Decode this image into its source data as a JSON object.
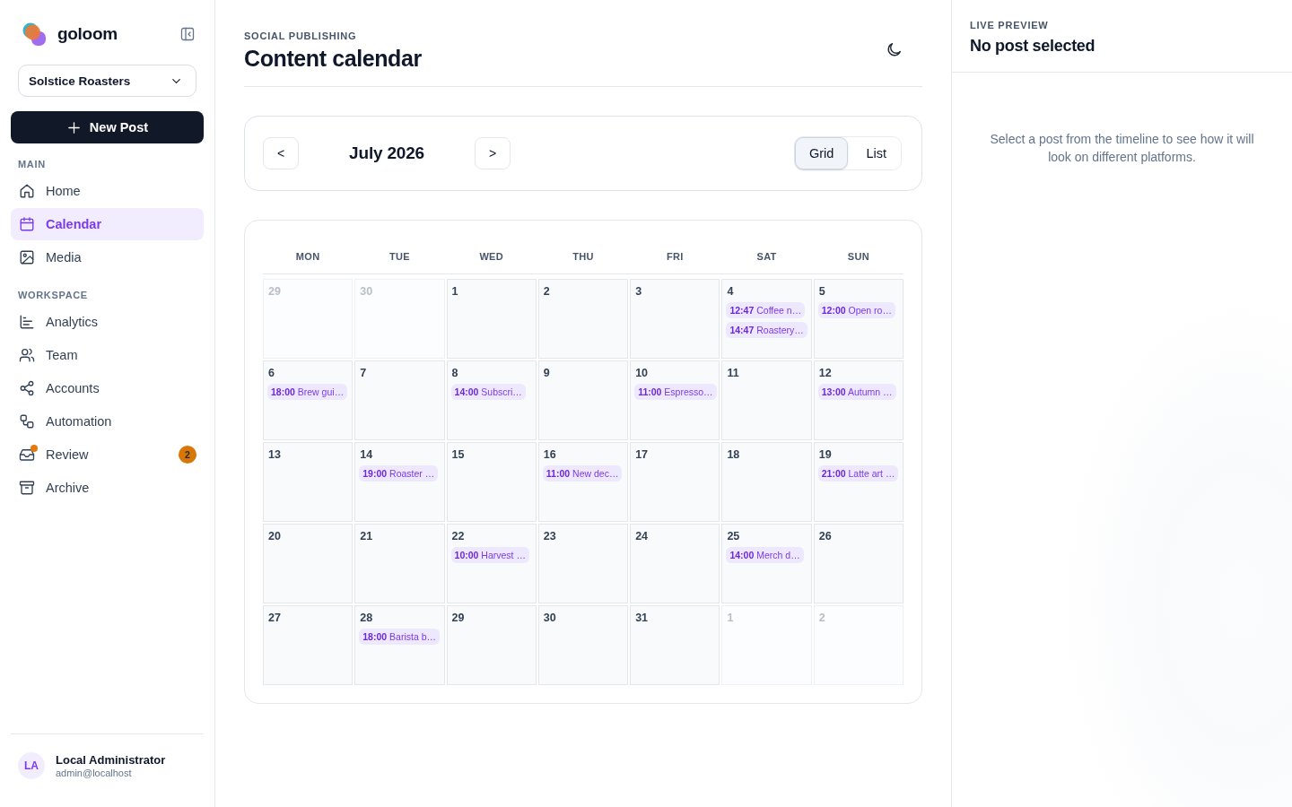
{
  "sidebar": {
    "brand": "goloom",
    "workspace_select": "Solstice Roasters",
    "new_post_button": "New Post",
    "sections": [
      {
        "label": "MAIN",
        "items": [
          {
            "label": "Home",
            "selected": false,
            "notification": false
          },
          {
            "label": "Calendar",
            "selected": true,
            "notification": false
          },
          {
            "label": "Media",
            "selected": false,
            "notification": false
          }
        ]
      },
      {
        "label": "WORKSPACE",
        "items": [
          {
            "label": "Analytics",
            "selected": false,
            "notification": false
          },
          {
            "label": "Team",
            "selected": false,
            "notification": false
          },
          {
            "label": "Accounts",
            "selected": false,
            "notification": false
          },
          {
            "label": "Automation",
            "selected": false,
            "notification": false
          },
          {
            "label": "Review",
            "selected": false,
            "notification": true,
            "badge": "2"
          },
          {
            "label": "Archive",
            "selected": false,
            "notification": false
          }
        ]
      }
    ],
    "user": {
      "initials": "LA",
      "name": "Local Administrator",
      "email": "admin@localhost"
    }
  },
  "header": {
    "eyebrow": "SOCIAL PUBLISHING",
    "title": "Content calendar"
  },
  "toolbar": {
    "prev": "<",
    "month": "July 2026",
    "next": ">",
    "views": [
      {
        "label": "Grid",
        "selected": true
      },
      {
        "label": "List",
        "selected": false
      }
    ]
  },
  "calendar": {
    "weekdays": [
      "MON",
      "TUE",
      "WED",
      "THU",
      "FRI",
      "SAT",
      "SUN"
    ],
    "weeks": [
      {
        "days": [
          {
            "day": "29",
            "in_month": false
          },
          {
            "day": "30",
            "in_month": false
          },
          {
            "day": "1",
            "in_month": true
          },
          {
            "day": "2",
            "in_month": true
          },
          {
            "day": "3",
            "in_month": true
          },
          {
            "day": "4",
            "in_month": true,
            "posts": [
              {
                "time": "12:47",
                "title": "Coffee n…"
              },
              {
                "time": "14:47",
                "title": "Roastery…"
              }
            ]
          },
          {
            "day": "5",
            "in_month": true,
            "posts": [
              {
                "time": "12:00",
                "title": "Open ro…"
              }
            ]
          }
        ]
      },
      {
        "days": [
          {
            "day": "6",
            "in_month": true,
            "posts": [
              {
                "time": "18:00",
                "title": "Brew gui…"
              }
            ]
          },
          {
            "day": "7",
            "in_month": true
          },
          {
            "day": "8",
            "in_month": true,
            "posts": [
              {
                "time": "14:00",
                "title": "Subscri…"
              }
            ]
          },
          {
            "day": "9",
            "in_month": true
          },
          {
            "day": "10",
            "in_month": true,
            "posts": [
              {
                "time": "11:00",
                "title": "Espresso…"
              }
            ]
          },
          {
            "day": "11",
            "in_month": true
          },
          {
            "day": "12",
            "in_month": true,
            "posts": [
              {
                "time": "13:00",
                "title": "Autumn …"
              }
            ]
          }
        ]
      },
      {
        "days": [
          {
            "day": "13",
            "in_month": true
          },
          {
            "day": "14",
            "in_month": true,
            "posts": [
              {
                "time": "19:00",
                "title": "Roaster …"
              }
            ]
          },
          {
            "day": "15",
            "in_month": true
          },
          {
            "day": "16",
            "in_month": true,
            "posts": [
              {
                "time": "11:00",
                "title": "New dec…"
              }
            ]
          },
          {
            "day": "17",
            "in_month": true
          },
          {
            "day": "18",
            "in_month": true
          },
          {
            "day": "19",
            "in_month": true,
            "posts": [
              {
                "time": "21:00",
                "title": "Latte art …"
              }
            ]
          }
        ]
      },
      {
        "days": [
          {
            "day": "20",
            "in_month": true
          },
          {
            "day": "21",
            "in_month": true
          },
          {
            "day": "22",
            "in_month": true,
            "posts": [
              {
                "time": "10:00",
                "title": "Harvest …"
              }
            ]
          },
          {
            "day": "23",
            "in_month": true
          },
          {
            "day": "24",
            "in_month": true
          },
          {
            "day": "25",
            "in_month": true,
            "posts": [
              {
                "time": "14:00",
                "title": "Merch d…"
              }
            ]
          },
          {
            "day": "26",
            "in_month": true
          }
        ]
      },
      {
        "days": [
          {
            "day": "27",
            "in_month": true
          },
          {
            "day": "28",
            "in_month": true,
            "posts": [
              {
                "time": "18:00",
                "title": "Barista b…"
              }
            ]
          },
          {
            "day": "29",
            "in_month": true
          },
          {
            "day": "30",
            "in_month": true
          },
          {
            "day": "31",
            "in_month": true
          },
          {
            "day": "1",
            "in_month": false
          },
          {
            "day": "2",
            "in_month": false
          }
        ]
      }
    ]
  },
  "preview": {
    "eyebrow": "LIVE PREVIEW",
    "title": "No post selected",
    "message": "Select a post from the timeline to see how it will look on different platforms."
  }
}
